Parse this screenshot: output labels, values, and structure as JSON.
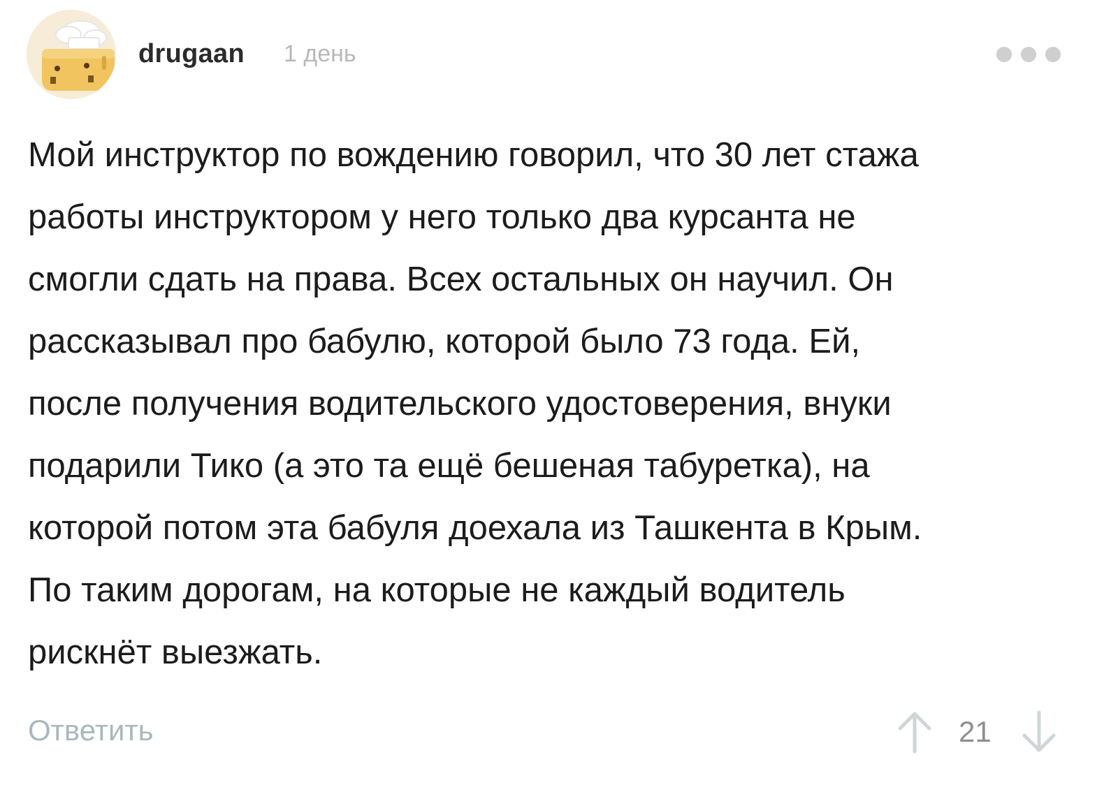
{
  "comment": {
    "author": "drugaan",
    "time": "1 день",
    "avatar_icon": "toaster-chef-hat-icon",
    "more_icon": "more-dots-icon",
    "body_lines": [
      "Мой инструктор по вождению говорил, что 30 лет стажа",
      "работы инструктором у него только два курсанта не",
      "смогли сдать на права. Всех остальных он научил. Он",
      "рассказывал про бабулю, которой было 73 года. Ей,",
      "после получения водительского удостоверения, внуки",
      "подарили Тико (а это та ещё бешеная табуретка), на",
      "которой потом эта бабуля доехала из Ташкента в Крым.",
      "По таким дорогам, на которые не каждый водитель",
      "рискнёт выезжать."
    ],
    "reply_label": "Ответить",
    "rating": "21",
    "upvote_icon": "arrow-up-icon",
    "downvote_icon": "arrow-down-icon"
  },
  "colors": {
    "text": "#1c1c1c",
    "muted": "#b8b8b8",
    "reply": "#a9b8bd",
    "arrow": "#cfd6d8",
    "dots": "#cfcfcf"
  }
}
